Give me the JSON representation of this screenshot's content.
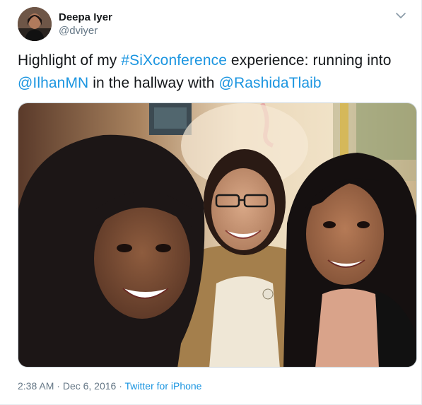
{
  "tweet": {
    "author": {
      "display_name": "Deepa Iyer",
      "handle": "@dviyer"
    },
    "text": {
      "part1": "Highlight of my ",
      "hashtag": "#SiXconference",
      "part2": " experience: running into ",
      "mention1": "@IlhanMN",
      "part3": " in the hallway with ",
      "mention2": "@RashidaTlaib"
    },
    "time": "2:38 AM",
    "separator": " · ",
    "date": "Dec 6, 2016",
    "source": "Twitter for iPhone"
  },
  "icons": {
    "menu": "chevron-down-icon"
  },
  "colors": {
    "link": "#1b95e0",
    "secondary_text": "#657786",
    "primary_text": "#14171a"
  }
}
